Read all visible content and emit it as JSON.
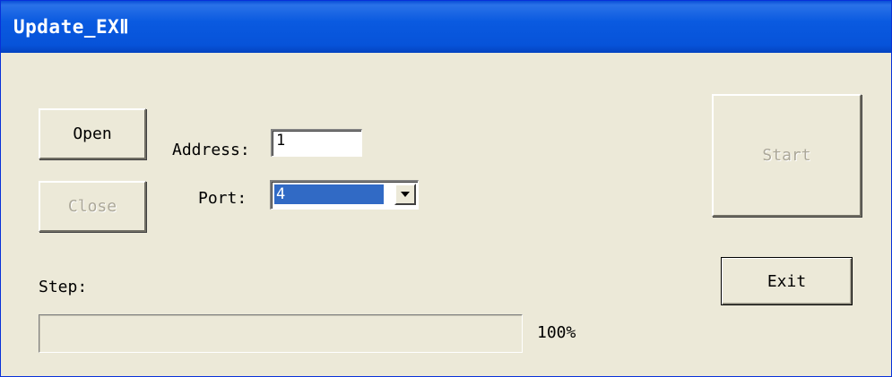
{
  "window": {
    "title": "Update_EXⅡ"
  },
  "buttons": {
    "open": "Open",
    "close": "Close",
    "start": "Start",
    "exit": "Exit"
  },
  "form": {
    "address_label": "Address:",
    "address_value": "1",
    "port_label": "Port:",
    "port_value": "4"
  },
  "progress": {
    "step_label": "Step:",
    "percent_text": "100%",
    "value": 1.0
  },
  "colors": {
    "title_bar": "#0753d9",
    "window_face": "#ece9d8",
    "selection": "#316ac5",
    "disabled_text": "#aca899"
  },
  "icons": {
    "combo_arrow": "chevron-down-icon"
  }
}
